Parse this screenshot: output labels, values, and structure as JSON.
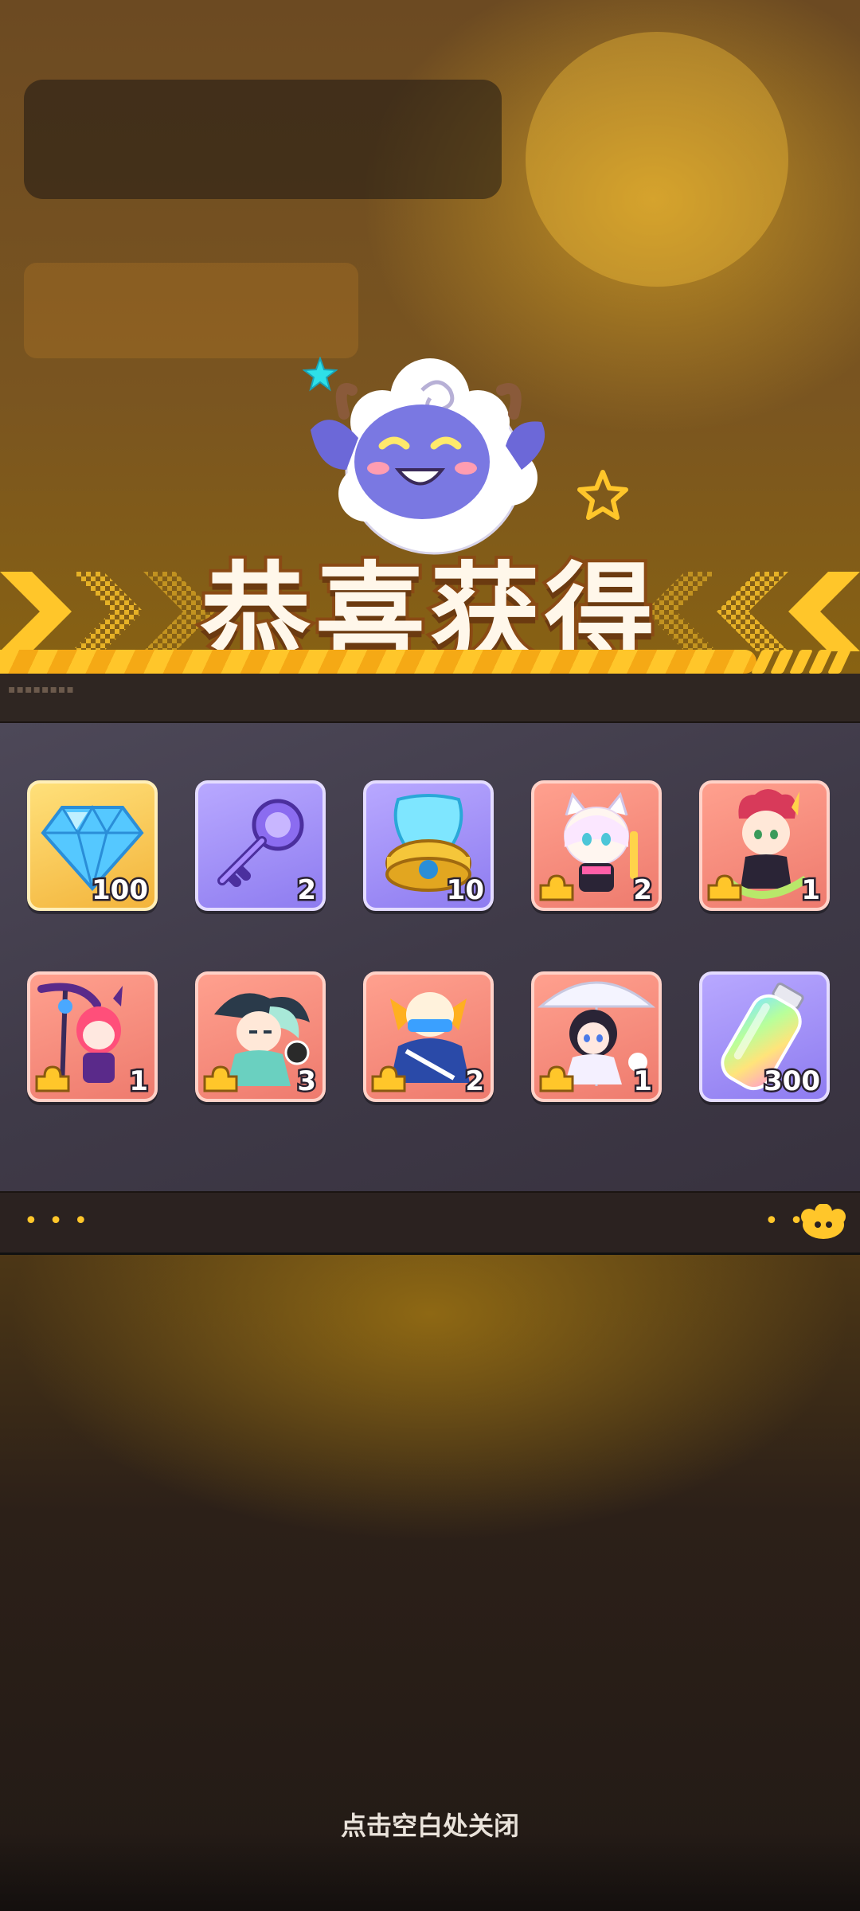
{
  "title": "恭喜获得",
  "close_hint": "点击空白处关闭",
  "items": [
    {
      "name": "diamond",
      "icon": "diamond-icon",
      "rarity": "gold",
      "count": "100"
    },
    {
      "name": "key",
      "icon": "key-icon",
      "rarity": "purple",
      "count": "2"
    },
    {
      "name": "energy-core",
      "icon": "energy-core-icon",
      "rarity": "purple",
      "count": "10"
    },
    {
      "name": "character-fragment-catgirl",
      "icon": "character-fragment-icon",
      "rarity": "red",
      "count": "2"
    },
    {
      "name": "character-fragment-demon",
      "icon": "character-fragment-icon",
      "rarity": "red",
      "count": "1"
    },
    {
      "name": "character-fragment-reaper",
      "icon": "character-fragment-icon",
      "rarity": "red",
      "count": "1"
    },
    {
      "name": "character-fragment-taoist",
      "icon": "character-fragment-icon",
      "rarity": "red",
      "count": "3"
    },
    {
      "name": "character-fragment-warrior",
      "icon": "character-fragment-icon",
      "rarity": "red",
      "count": "2"
    },
    {
      "name": "character-fragment-umbrella",
      "icon": "character-fragment-icon",
      "rarity": "red",
      "count": "1"
    },
    {
      "name": "rainbow-bottle",
      "icon": "bottle-icon",
      "rarity": "purple",
      "count": "300"
    }
  ],
  "colors": {
    "accent_yellow": "#ffc62a",
    "gold_frame": "#f3b43b",
    "purple_frame": "#8e7cf0",
    "red_frame": "#ee7b6e"
  }
}
